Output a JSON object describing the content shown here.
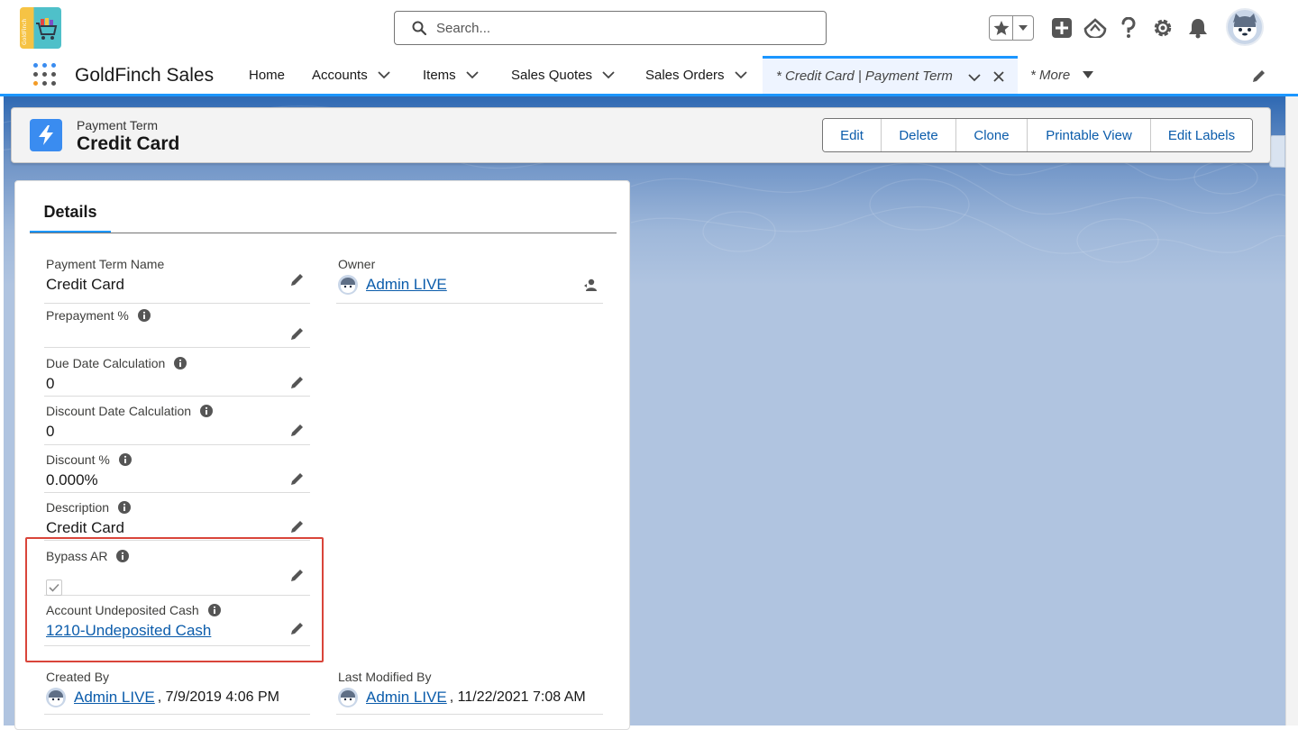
{
  "header": {
    "logo_text": "GoldFinch",
    "search": {
      "placeholder": "Search..."
    }
  },
  "nav": {
    "app_name": "GoldFinch Sales",
    "items": [
      {
        "label": "Home",
        "has_menu": false
      },
      {
        "label": "Accounts",
        "has_menu": true
      },
      {
        "label": "Items",
        "has_menu": true
      },
      {
        "label": "Sales Quotes",
        "has_menu": true
      },
      {
        "label": "Sales Orders",
        "has_menu": true
      }
    ],
    "active_tab": {
      "label": "* Credit Card | Payment Term"
    },
    "more_label": "* More"
  },
  "record": {
    "type_label": "Payment Term",
    "title": "Credit Card",
    "actions": {
      "edit": "Edit",
      "delete": "Delete",
      "clone": "Clone",
      "printable_view": "Printable View",
      "edit_labels": "Edit Labels"
    }
  },
  "details": {
    "tab_label": "Details",
    "fields": {
      "payment_term_name": {
        "label": "Payment Term Name",
        "value": "Credit Card"
      },
      "prepayment": {
        "label": "Prepayment %",
        "value": ""
      },
      "due_date_calc": {
        "label": "Due Date Calculation",
        "value": "0"
      },
      "discount_date_calc": {
        "label": "Discount Date Calculation",
        "value": "0"
      },
      "discount_pct": {
        "label": "Discount %",
        "value": "0.000%"
      },
      "description": {
        "label": "Description",
        "value": "Credit Card"
      },
      "bypass_ar": {
        "label": "Bypass AR",
        "checked": true
      },
      "account_undeposited_cash": {
        "label": "Account Undeposited Cash",
        "value": "1210-Undeposited Cash"
      },
      "owner": {
        "label": "Owner",
        "user": "Admin LIVE"
      },
      "created_by": {
        "label": "Created By",
        "user": "Admin LIVE",
        "date": ", 7/9/2019 4:06 PM"
      },
      "last_modified_by": {
        "label": "Last Modified By",
        "user": "Admin LIVE",
        "date": ", 11/22/2021 7:08 AM"
      }
    }
  },
  "colors": {
    "brand_blue": "#1b96ff",
    "link_blue": "#0b5cab",
    "highlight_red": "#d9453a",
    "record_icon": "#3a8cf0"
  }
}
